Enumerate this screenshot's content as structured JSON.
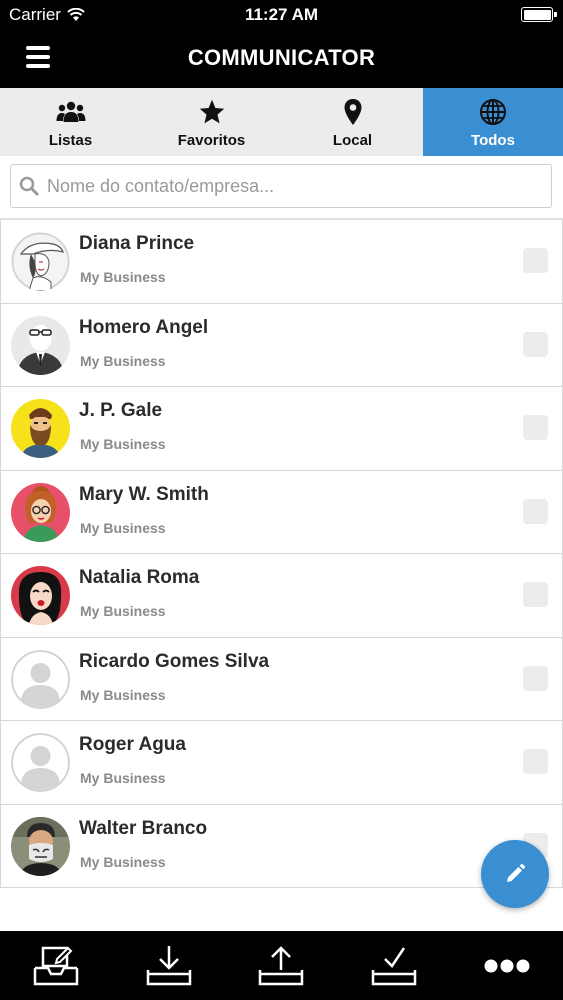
{
  "status_bar": {
    "carrier": "Carrier",
    "time": "11:27 AM"
  },
  "nav": {
    "title": "COMMUNICATOR"
  },
  "tabs": [
    {
      "label": "Listas",
      "icon": "group-icon",
      "active": false
    },
    {
      "label": "Favoritos",
      "icon": "star-icon",
      "active": false
    },
    {
      "label": "Local",
      "icon": "map-pin-icon",
      "active": false
    },
    {
      "label": "Todos",
      "icon": "globe-icon",
      "active": true
    }
  ],
  "search": {
    "placeholder": "Nome do contato/empresa...",
    "value": ""
  },
  "contacts": [
    {
      "name": "Diana Prince",
      "business": "My Business",
      "avatar": "illustrated-woman-hat"
    },
    {
      "name": "Homero Angel",
      "business": "My Business",
      "avatar": "suit-man-glasses"
    },
    {
      "name": "J. P. Gale",
      "business": "My Business",
      "avatar": "bearded-man-yellow"
    },
    {
      "name": "Mary W. Smith",
      "business": "My Business",
      "avatar": "popart-woman-glasses"
    },
    {
      "name": "Natalia Roma",
      "business": "My Business",
      "avatar": "popart-woman-red"
    },
    {
      "name": "Ricardo Gomes Silva",
      "business": "My Business",
      "avatar": "default-silhouette"
    },
    {
      "name": "Roger Agua",
      "business": "My Business",
      "avatar": "default-silhouette"
    },
    {
      "name": "Walter Branco",
      "business": "My Business",
      "avatar": "man-with-mask"
    }
  ],
  "toolbar": [
    {
      "icon": "compose-inbox-icon"
    },
    {
      "icon": "download-icon"
    },
    {
      "icon": "upload-icon"
    },
    {
      "icon": "checkmark-tray-icon"
    },
    {
      "icon": "more-icon"
    }
  ],
  "colors": {
    "accent": "#3a8fd3",
    "bar": "#000000",
    "tab_bg": "#ececec"
  }
}
